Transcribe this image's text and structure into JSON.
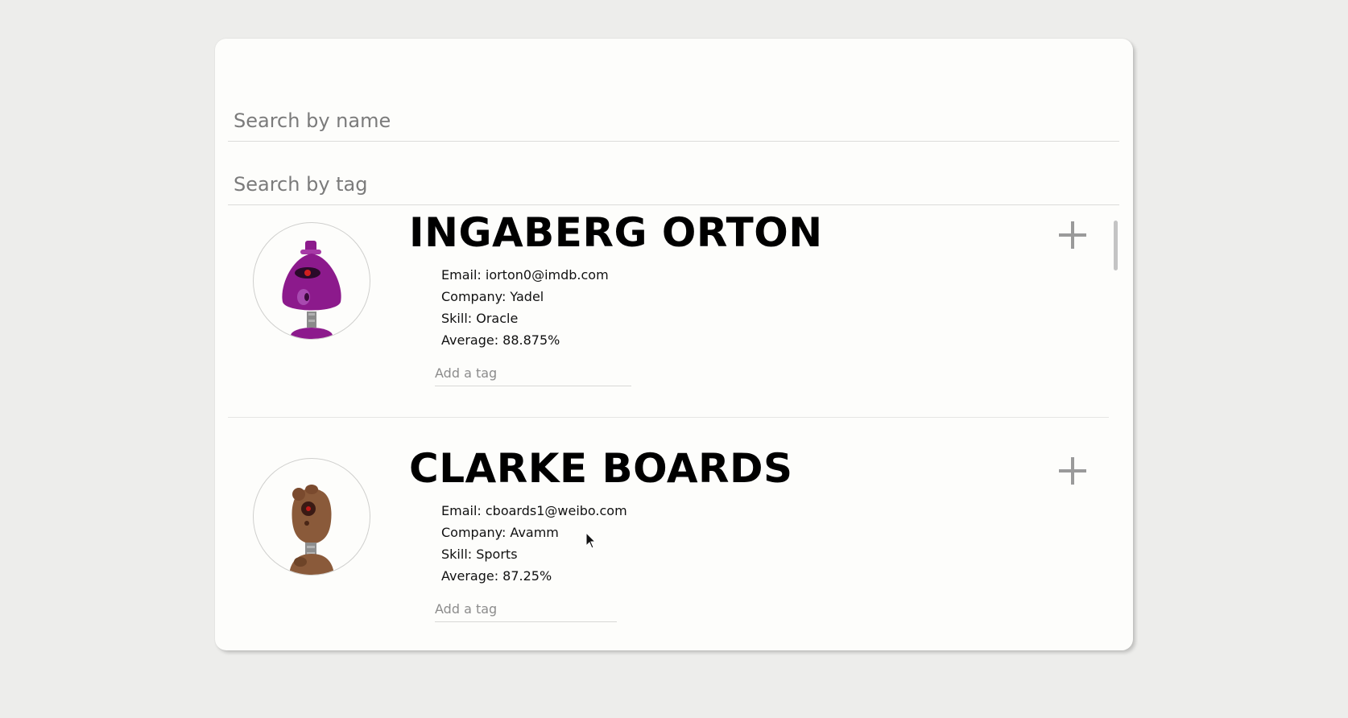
{
  "search": {
    "name_placeholder": "Search by name",
    "tag_placeholder": "Search by tag"
  },
  "students": [
    {
      "name": "INGABERG ORTON",
      "email": "Email: iorton0@imdb.com",
      "company": "Company: Yadel",
      "skill": "Skill: Oracle",
      "average": "Average: 88.875%",
      "tag_placeholder": "Add a tag",
      "avatar_icon": "purple-robot-avatar-icon",
      "avatar_color": "#8c1a8c"
    },
    {
      "name": "CLARKE BOARDS",
      "email": "Email: cboards1@weibo.com",
      "company": "Company: Avamm",
      "skill": "Skill: Sports",
      "average": "Average: 87.25%",
      "tag_placeholder": "Add a tag",
      "avatar_icon": "brown-robot-avatar-icon",
      "avatar_color": "#8a5a3a"
    }
  ],
  "colors": {
    "page_background": "#ededeb",
    "card_background": "#fdfdfb",
    "expand_icon": "#9a9a9a"
  }
}
